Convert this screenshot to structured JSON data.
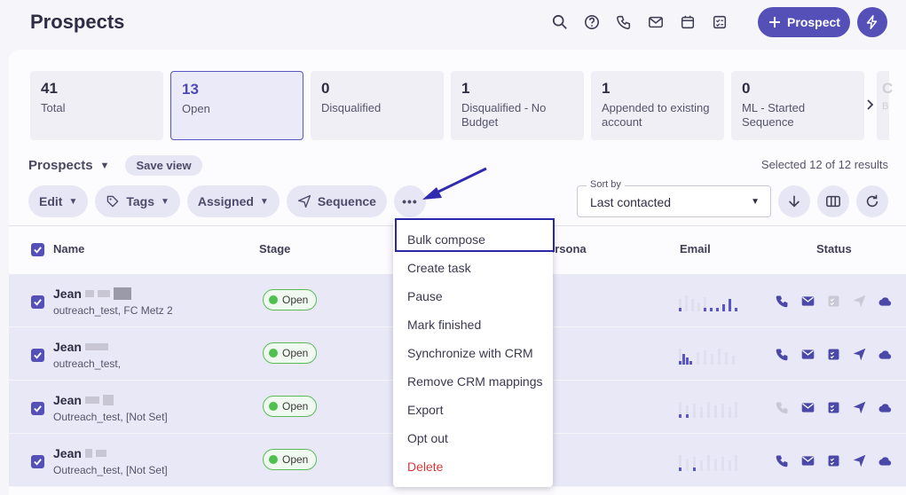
{
  "header": {
    "title": "Prospects",
    "add_button": "Prospect"
  },
  "top_icons": [
    "search-icon",
    "help-icon",
    "phone-icon",
    "mail-icon",
    "calendar-icon",
    "tasks-icon"
  ],
  "cards": [
    {
      "count": "41",
      "label": "Total"
    },
    {
      "count": "13",
      "label": "Open"
    },
    {
      "count": "0",
      "label": "Disqualified"
    },
    {
      "count": "1",
      "label": "Disqualified - No Budget"
    },
    {
      "count": "1",
      "label": "Appended to existing account"
    },
    {
      "count": "0",
      "label": "ML - Started Sequence"
    }
  ],
  "card_edge": {
    "count": "C",
    "label": "B"
  },
  "view": {
    "title": "Prospects",
    "save_view": "Save view",
    "selected": "Selected 12 of 12 results"
  },
  "actions": {
    "edit": "Edit",
    "tags": "Tags",
    "assigned": "Assigned",
    "sequence": "Sequence",
    "more": "•••"
  },
  "sort": {
    "label": "Sort by",
    "value": "Last contacted"
  },
  "columns": {
    "name": "Name",
    "stage": "Stage",
    "persona": "ersona",
    "email": "Email",
    "status": "Status"
  },
  "rows": [
    {
      "first_name": "Jean",
      "sub": "outreach_test, FC Metz 2",
      "stage": "Open"
    },
    {
      "first_name": "Jean",
      "sub": "outreach_test,",
      "stage": "Open"
    },
    {
      "first_name": "Jean",
      "sub": "Outreach_test, [Not Set]",
      "stage": "Open"
    },
    {
      "first_name": "Jean",
      "sub": "Outreach_test, [Not Set]",
      "stage": "Open"
    }
  ],
  "menu": {
    "items": [
      "Bulk compose",
      "Create task",
      "Pause",
      "Mark finished",
      "Synchronize with CRM",
      "Remove CRM mappings",
      "Export",
      "Opt out",
      "Delete"
    ]
  },
  "colors": {
    "accent": "#5450b8",
    "danger": "#d23a3a",
    "open_green": "#4fbf4f"
  }
}
